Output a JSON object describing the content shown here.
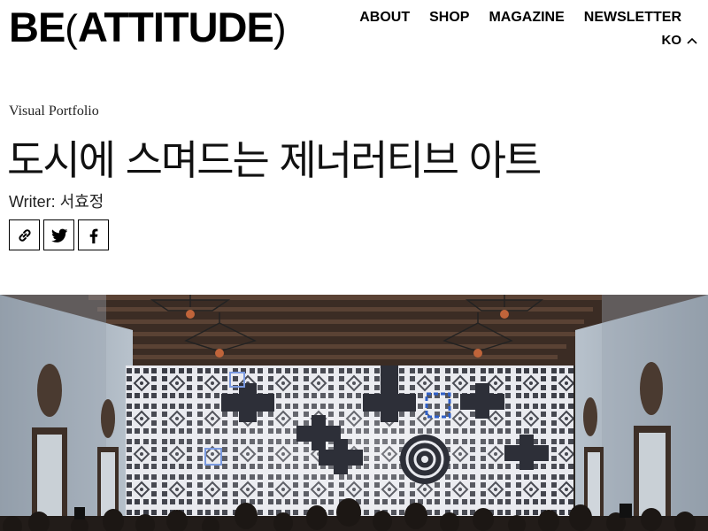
{
  "header": {
    "logo": {
      "left": "BE",
      "paren_open": "(",
      "word": "ATTITUDE",
      "paren_close": ")"
    },
    "nav": [
      "ABOUT",
      "SHOP",
      "MAGAZINE",
      "NEWSLETTER"
    ],
    "language": "KO",
    "language_icon": "chevron-up-icon"
  },
  "article": {
    "category": "Visual Portfolio",
    "title": "도시에 스며드는 제너러티브 아트",
    "writer": "Writer: 서효정"
  },
  "share": [
    {
      "icon": "link-icon"
    },
    {
      "icon": "twitter-icon"
    },
    {
      "icon": "facebook-icon"
    }
  ],
  "hero_image": {
    "description_icon": "hero-photo"
  }
}
